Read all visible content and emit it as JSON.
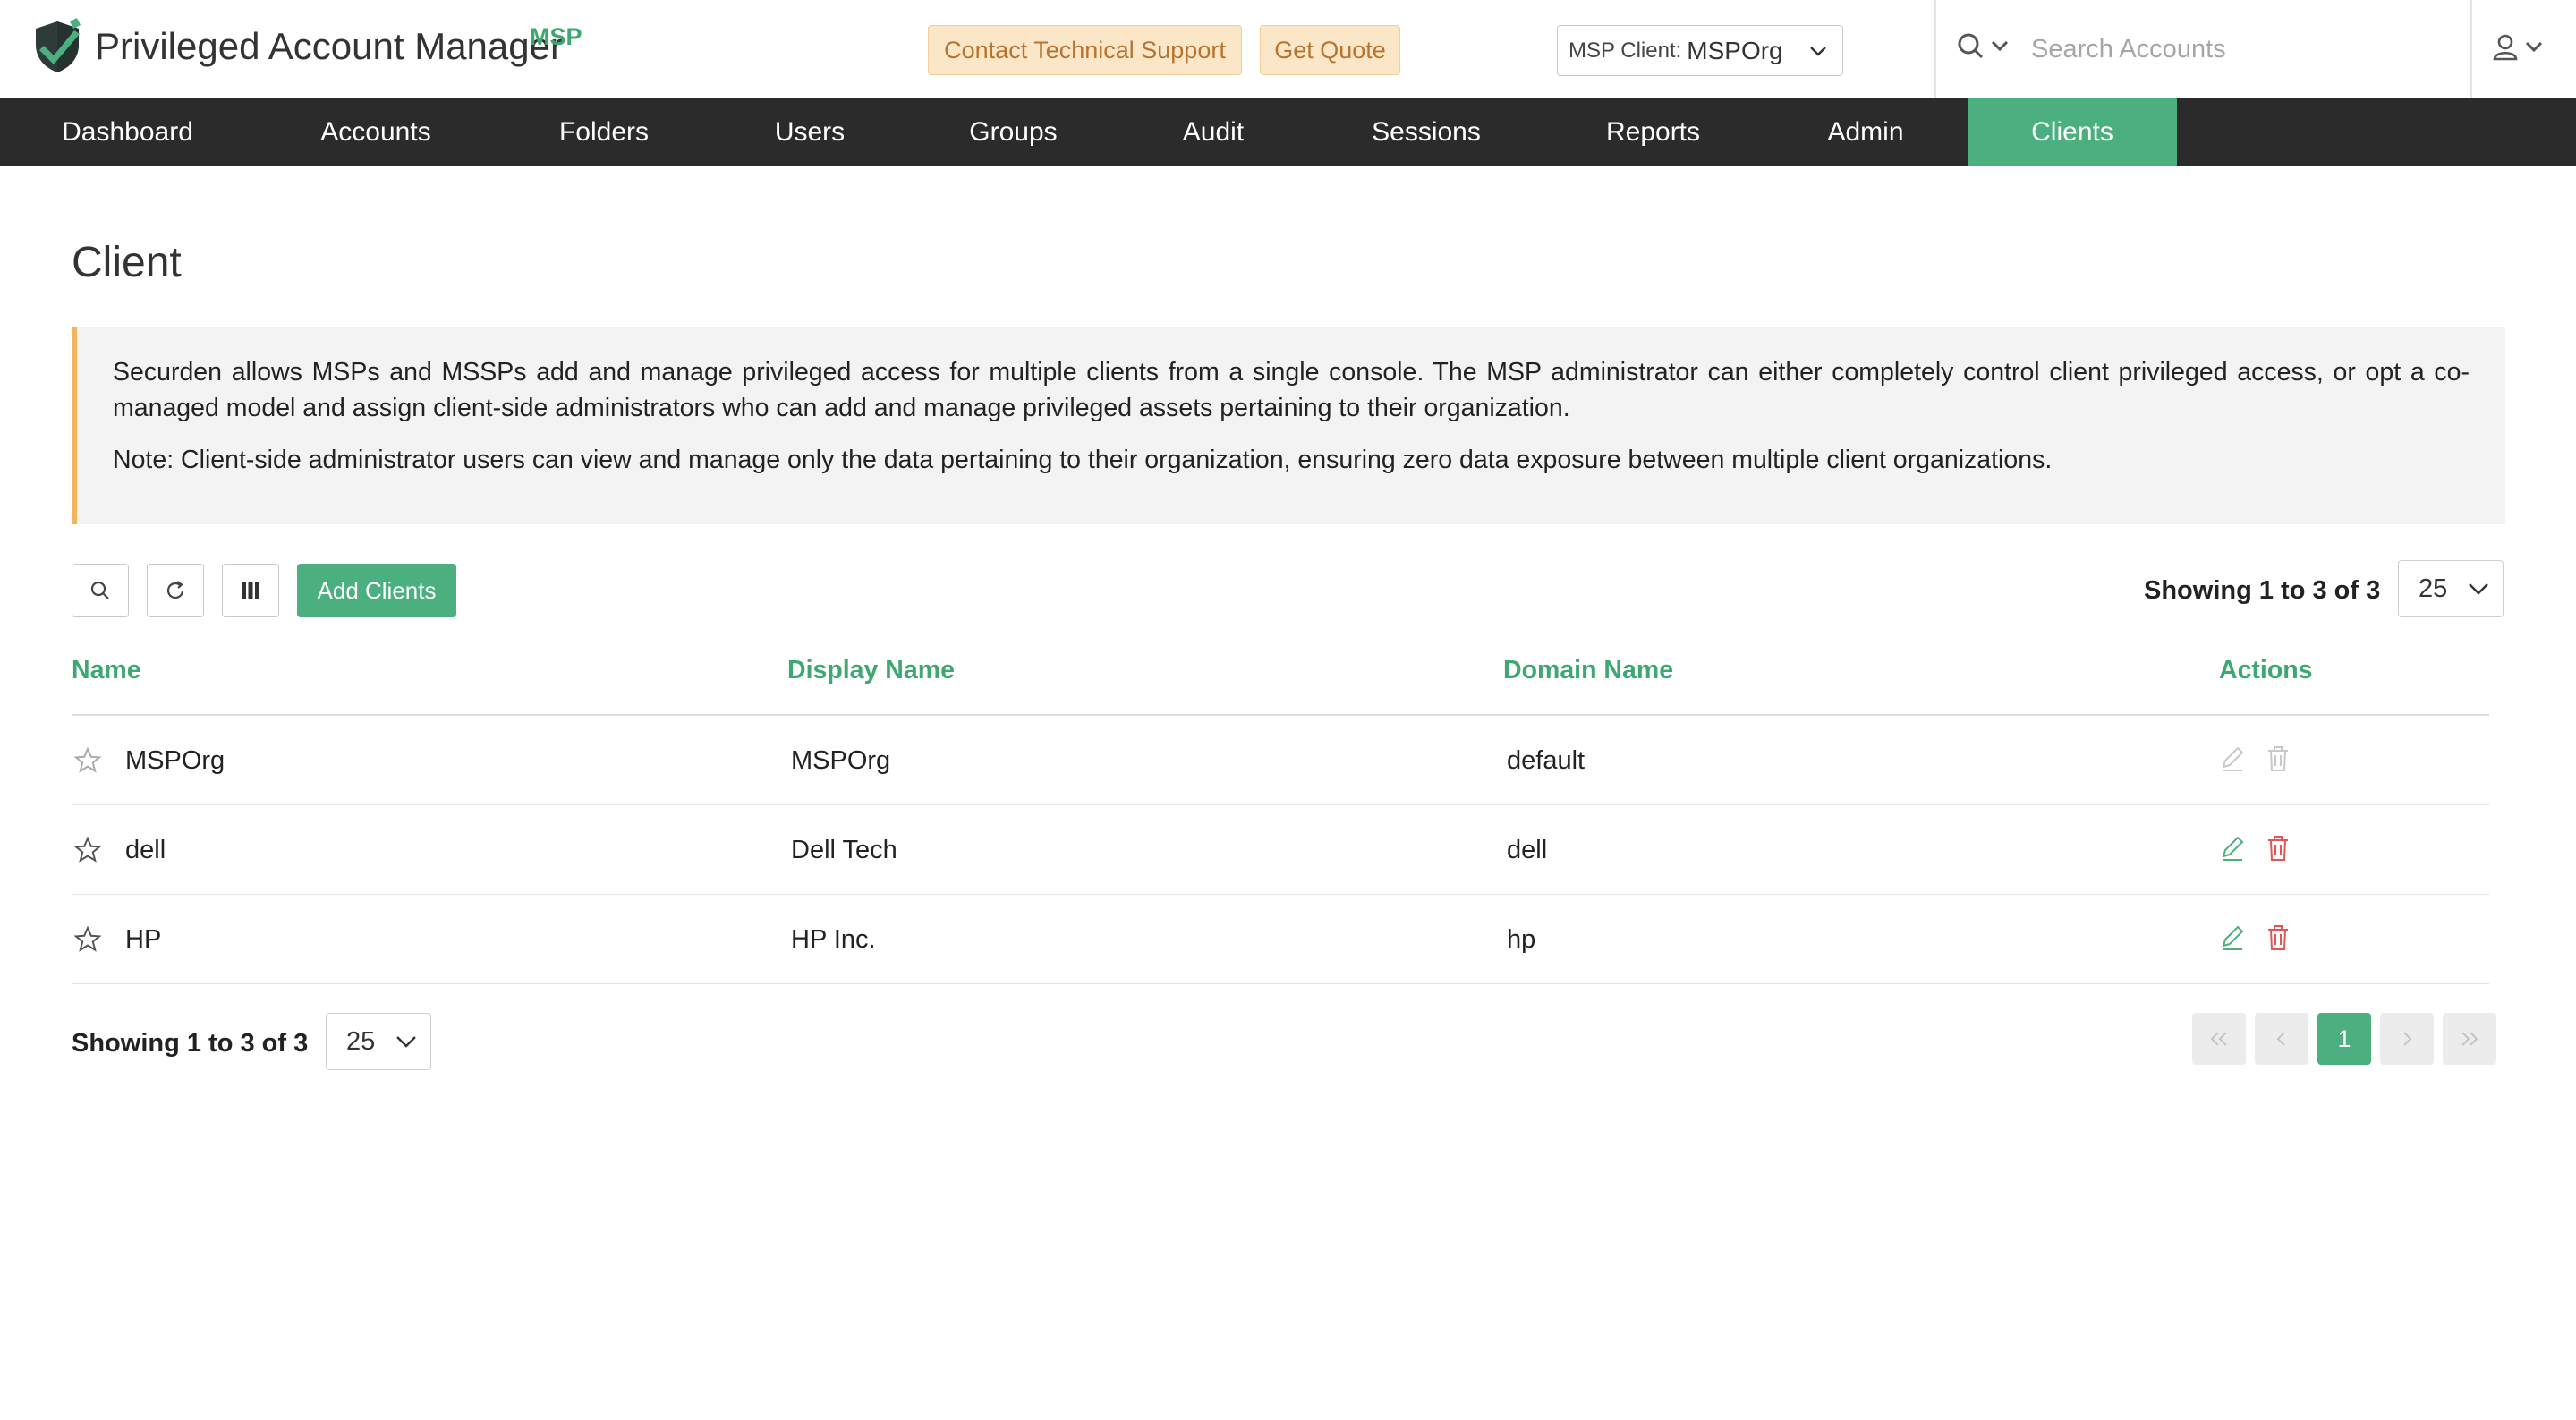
{
  "header": {
    "brand": "Privileged Account Manager",
    "brand_badge": "MSP",
    "support_button": "Contact Technical Support",
    "quote_button": "Get Quote",
    "client_select_label": "MSP Client:",
    "client_select_value": "MSPOrg",
    "search_placeholder": "Search Accounts"
  },
  "nav": {
    "items": [
      {
        "label": "Dashboard"
      },
      {
        "label": "Accounts"
      },
      {
        "label": "Folders"
      },
      {
        "label": "Users"
      },
      {
        "label": "Groups"
      },
      {
        "label": "Audit"
      },
      {
        "label": "Sessions"
      },
      {
        "label": "Reports"
      },
      {
        "label": "Admin"
      },
      {
        "label": "Clients"
      }
    ],
    "active": "Clients"
  },
  "page": {
    "title": "Client",
    "info": "Securden allows MSPs and MSSPs add and manage privileged access for multiple clients from a single console. The MSP administrator can either completely control client privileged access, or opt a co-managed model and assign client-side administrators who can add and manage privileged assets pertaining to their organization.",
    "note": "Note: Client-side administrator users can view and manage only the data pertaining to their organization, ensuring zero data exposure between multiple client organizations."
  },
  "toolbar": {
    "add_button": "Add Clients",
    "showing": "Showing 1 to 3 of 3",
    "page_size": "25"
  },
  "table": {
    "columns": [
      "Name",
      "Display Name",
      "Domain Name",
      "Actions"
    ],
    "rows": [
      {
        "name": "MSPOrg",
        "display_name": "MSPOrg",
        "domain": "default",
        "actions_enabled": false
      },
      {
        "name": "dell",
        "display_name": "Dell Tech",
        "domain": "dell",
        "actions_enabled": true
      },
      {
        "name": "HP",
        "display_name": "HP Inc.",
        "domain": "hp",
        "actions_enabled": true
      }
    ]
  },
  "footer": {
    "showing": "Showing 1 to 3 of 3",
    "page_size": "25",
    "current_page": "1"
  },
  "colors": {
    "accent": "#4caf7f",
    "nav_bg": "#2b2b2b",
    "warning_bg": "#fbe6c8",
    "delete_red": "#e05555"
  },
  "icons": {
    "logo": "shield-check-icon",
    "search": "search-icon",
    "user": "user-icon",
    "refresh": "refresh-icon",
    "columns": "columns-icon",
    "favorite": "star-icon",
    "edit": "pencil-icon",
    "delete": "trash-icon"
  }
}
